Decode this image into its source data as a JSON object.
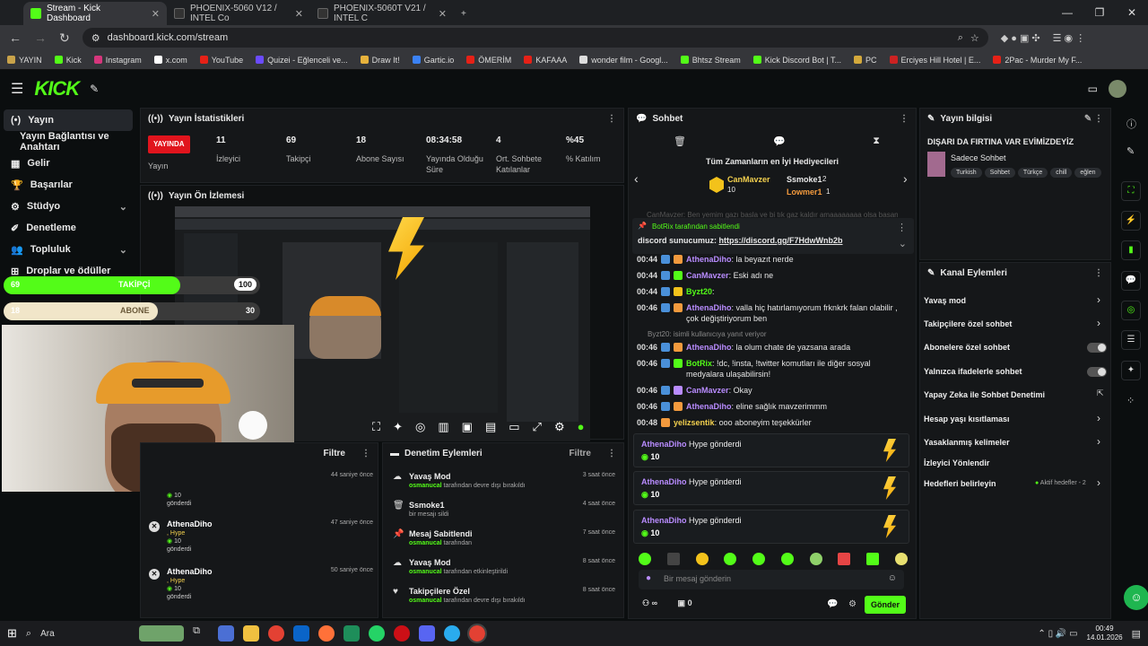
{
  "browser": {
    "tabs": [
      {
        "title": "Stream - Kick Dashboard"
      },
      {
        "title": "PHOENIX-5060 V12 / INTEL Co"
      },
      {
        "title": "PHOENIX-5060T V21 / INTEL C"
      }
    ],
    "url": "dashboard.kick.com/stream",
    "bookmarks": [
      "YAYIN",
      "Kick",
      "Instagram",
      "x.com",
      "YouTube",
      "Quizei - Eğlenceli ve...",
      "Draw It!",
      "Gartic.io",
      "ÖMERİM",
      "KAFAAA",
      "wonder film - Googl...",
      "Bhtsz Stream",
      "Kick Discord Bot | T...",
      "PC",
      "Erciyes Hill Hotel | E...",
      "2Pac - Murder My F..."
    ]
  },
  "sidebar": {
    "items": [
      {
        "label": "Yayın"
      },
      {
        "label": "Yayın Bağlantısı ve Anahtarı"
      },
      {
        "label": "Gelir"
      },
      {
        "label": "Başarılar"
      },
      {
        "label": "Stüdyo"
      },
      {
        "label": "Denetleme"
      },
      {
        "label": "Topluluk"
      },
      {
        "label": "Droplar ve ödüller"
      }
    ]
  },
  "stats": {
    "title": "Yayın İstatistikleri",
    "live": "YAYINDA",
    "items": [
      {
        "value": "",
        "label": "Yayın"
      },
      {
        "value": "11",
        "label": "İzleyici"
      },
      {
        "value": "69",
        "label": "Takipçi"
      },
      {
        "value": "18",
        "label": "Abone Sayısı"
      },
      {
        "value": "08:34:58",
        "label": "Yayında Olduğu Süre"
      },
      {
        "value": "4",
        "label": "Ort. Sohbete Katılanlar"
      },
      {
        "value": "%45",
        "label": "% Katılım"
      }
    ]
  },
  "preview": {
    "title": "Yayın Ön İzlemesi"
  },
  "goals": [
    {
      "left": "69",
      "label": "TAKİPÇİ",
      "right": "100",
      "progress": 0.69,
      "color": "#53fc18"
    },
    {
      "left": "18",
      "label": "ABONE",
      "right": "30",
      "progress": 0.6,
      "color": "#f1e6c9"
    }
  ],
  "alerts": {
    "filter": "Filtre",
    "first_time": "44 saniye önce",
    "first_amount": "10",
    "first_sent": "gönderdi",
    "rows": [
      {
        "name": "AthenaDiho",
        "kind": ", Hype",
        "amount": "10",
        "sent": "gönderdi",
        "time": "47 saniye önce"
      },
      {
        "name": "AthenaDiho",
        "kind": ", Hype",
        "amount": "10",
        "sent": "gönderdi",
        "time": "50 saniye önce"
      }
    ]
  },
  "moderation": {
    "title": "Denetim Eylemleri",
    "filter": "Filtre",
    "rows": [
      {
        "title": "Yavaş Mod",
        "user": "osmanucal",
        "rest": " tarafından devre dışı bırakıldı",
        "time": "3 saat önce"
      },
      {
        "title": "Ssmoke1",
        "user": "",
        "rest": "bir mesajı sildi",
        "time": "4 saat önce"
      },
      {
        "title": "Mesaj Sabitlendi",
        "user": "osmanucal",
        "rest": " tarafından",
        "time": "7 saat önce"
      },
      {
        "title": "Yavaş Mod",
        "user": "osmanucal",
        "rest": " tarafından etkinleştirildi",
        "time": "8 saat önce"
      },
      {
        "title": "Takipçilere Özel",
        "user": "osmanucal",
        "rest": " tarafından devre dışı bırakıldı",
        "time": "8 saat önce"
      }
    ]
  },
  "chat": {
    "title": "Sohbet",
    "gifters_title": "Tüm Zamanların en İyi Hediyecileri",
    "top1": {
      "name": "CanMavzer",
      "count": "10"
    },
    "top2": {
      "name": "Ssmoke1",
      "count": "2"
    },
    "top3": {
      "name": "Lowmer1",
      "count": "1"
    },
    "faded": "CanMavzer: Ben yemim gazı basla ve bi tık gaz kaldır amaaaaaaaa olsa basan oll",
    "pinned_by": "BotRix tarafından sabitlendi",
    "pinned_text": "discord sunucumuz: ",
    "pinned_link": "https://discord.gg/F7HdwWnb2b",
    "messages": [
      {
        "time": "00:44",
        "user": "AthenaDiho",
        "color": "#b98cff",
        "text": ": la beyazıt nerde"
      },
      {
        "time": "00:44",
        "user": "CanMavzer",
        "color": "#b98cff",
        "text": ": Eski adı ne"
      },
      {
        "time": "00:44",
        "user": "Byzt20",
        "color": "#53fc18",
        "text": ": "
      },
      {
        "time": "00:46",
        "user": "AthenaDiho",
        "color": "#b98cff",
        "text": ": valla hiç hatırlamıyorum frknkrk falan olabilir , çok değiştiriyorum ben"
      },
      {
        "time": "00:46",
        "user": "AthenaDiho",
        "color": "#b98cff",
        "text": ": la olum chate de yazsana arada"
      },
      {
        "time": "00:46",
        "user": "BotRix",
        "color": "#53fc18",
        "text": ": !dc, !insta, !twitter komutları ile diğer sosyal medyalara ulaşabilirsin!"
      },
      {
        "time": "00:46",
        "user": "CanMavzer",
        "color": "#b98cff",
        "text": ": Okay"
      },
      {
        "time": "00:46",
        "user": "AthenaDiho",
        "color": "#b98cff",
        "text": ": eline sağlık mavzerimmm"
      },
      {
        "time": "00:48",
        "user": "yelizsentik",
        "color": "#f3d04e",
        "text": ": ooo aboneyim teşekkürler"
      }
    ],
    "reply_note": "Byzt20:  isimli kullanıcıya yanıt veriyor",
    "hypes": [
      {
        "user": "AthenaDiho",
        "text": " Hype gönderdi",
        "amount": "10"
      },
      {
        "user": "AthenaDiho",
        "text": " Hype gönderdi",
        "amount": "10"
      },
      {
        "user": "AthenaDiho",
        "text": " Hype gönderdi",
        "amount": "10"
      }
    ],
    "input_placeholder": "Bir mesaj gönderin",
    "infinity": "∞",
    "count": "0",
    "send": "Gönder"
  },
  "info": {
    "title": "Yayın bilgisi",
    "stream_title": "DIŞARI DA FIRTINA VAR EVİMİZDEYİZ",
    "category": "Sadece Sohbet",
    "tags": [
      "Turkish",
      "Sohbet",
      "Türkçe",
      "chill",
      "eğlen"
    ]
  },
  "actions": {
    "title": "Kanal Eylemleri",
    "items": [
      {
        "label": "Yavaş mod",
        "kind": "chev"
      },
      {
        "label": "Takipçilere özel sohbet",
        "kind": "chev"
      },
      {
        "label": "Abonelere özel sohbet",
        "kind": "toggle"
      },
      {
        "label": "Yalnızca ifadelerle sohbet",
        "kind": "toggle"
      },
      {
        "label": "Yapay Zeka ile Sohbet Denetimi",
        "kind": "ext"
      },
      {
        "label": "Hesap yaşı kısıtlaması",
        "kind": "chev"
      },
      {
        "label": "Yasaklanmış kelimeler",
        "kind": "chev"
      },
      {
        "label": "İzleyici Yönlendir",
        "kind": "none"
      },
      {
        "label": "Hedefleri belirleyin",
        "kind": "chev"
      }
    ],
    "goals_badge": "Aktif hedefler - 2"
  },
  "taskbar": {
    "search": "Ara",
    "time": "00:49",
    "date": "14.01.2026"
  }
}
